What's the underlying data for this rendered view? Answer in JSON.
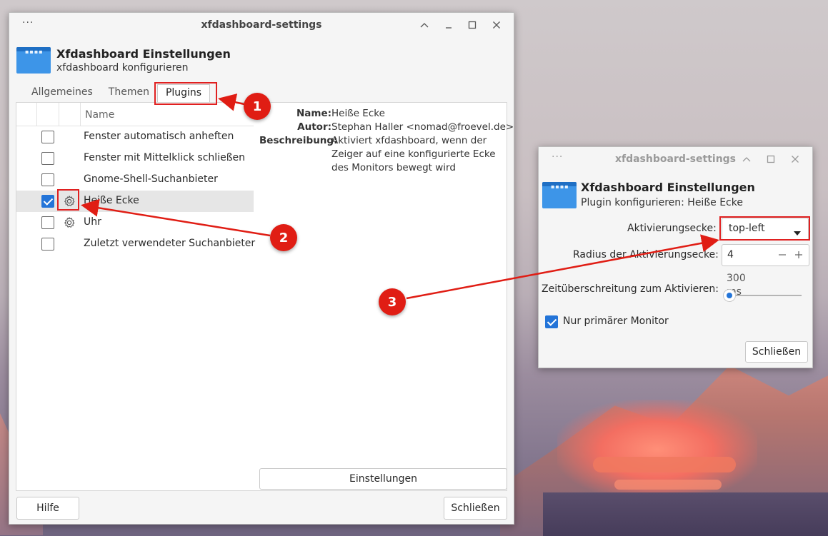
{
  "main_window": {
    "title": "xfdashboard-settings",
    "header_title": "Xfdashboard Einstellungen",
    "header_subtitle": "xfdashboard konfigurieren",
    "tabs": [
      {
        "label": "Allgemeines"
      },
      {
        "label": "Themen"
      },
      {
        "label": "Plugins"
      }
    ],
    "list_header_name": "Name",
    "plugins": [
      {
        "label": "Fenster automatisch anheften",
        "checked": false,
        "has_settings": false
      },
      {
        "label": "Fenster mit Mittelklick schließen",
        "checked": false,
        "has_settings": false
      },
      {
        "label": "Gnome-Shell-Suchanbieter",
        "checked": false,
        "has_settings": false
      },
      {
        "label": "Heiße Ecke",
        "checked": true,
        "has_settings": true,
        "selected": true
      },
      {
        "label": "Uhr",
        "checked": false,
        "has_settings": true
      },
      {
        "label": "Zuletzt verwendeter Suchanbieter",
        "checked": false,
        "has_settings": false
      }
    ],
    "details": {
      "name_label": "Name:",
      "name_value": "Heiße Ecke",
      "author_label": "Autor:",
      "author_value": "Stephan Haller <nomad@froevel.de>",
      "description_label": "Beschreibung:",
      "description_lines": [
        "Aktiviert xfdashboard, wenn der",
        "Zeiger auf eine konfigurierte Ecke",
        "des Monitors bewegt wird"
      ]
    },
    "settings_button": "Einstellungen",
    "help_button": "Hilfe",
    "close_button": "Schließen"
  },
  "plugin_window": {
    "title": "xfdashboard-settings",
    "header_title": "Xfdashboard Einstellungen",
    "header_subtitle": "Plugin konfigurieren: Heiße Ecke",
    "activation_corner_label": "Aktivierungsecke:",
    "activation_corner_value": "top-left",
    "radius_label": "Radius der Aktivierungsecke:",
    "radius_value": "4",
    "timeout_label": "Zeitüberschreitung zum Aktivieren:",
    "timeout_value": "300",
    "timeout_unit": "ms",
    "timeout_slider_fraction": 0.0,
    "primary_monitor_label": "Nur primärer Monitor",
    "primary_monitor_checked": true,
    "close_button": "Schließen"
  },
  "annotations": [
    {
      "number": "1"
    },
    {
      "number": "2"
    },
    {
      "number": "3"
    }
  ],
  "colors": {
    "accent": "#2374d8",
    "annotation": "#e01d14"
  }
}
